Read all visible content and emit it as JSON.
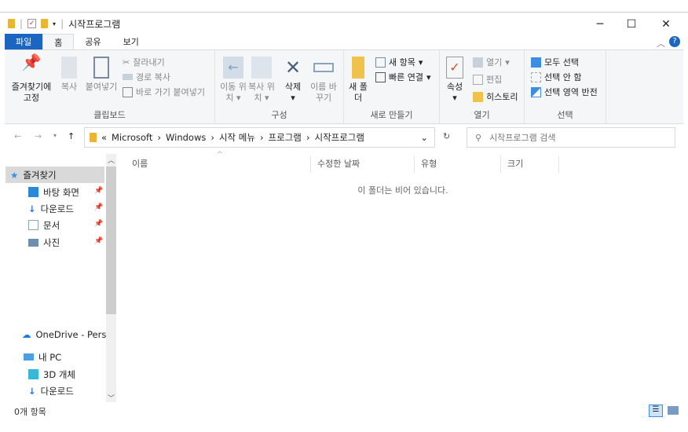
{
  "window": {
    "title": "시작프로그램",
    "minimize": "─",
    "maximize": "☐",
    "close": "✕"
  },
  "tabs": [
    "파일",
    "홈",
    "공유",
    "보기"
  ],
  "ribbon": {
    "clipboard": {
      "label": "클립보드",
      "pin": "즐겨찾기에 고정",
      "copy": "복사",
      "paste": "붙여넣기",
      "cut": "잘라내기",
      "copy_path": "경로 복사",
      "paste_shortcut": "바로 가기 붙여넣기"
    },
    "organize": {
      "label": "구성",
      "move_to": "이동 위치",
      "copy_to": "복사 위치",
      "delete": "삭제",
      "rename": "이름 바꾸기"
    },
    "new": {
      "label": "새로 만들기",
      "new_folder": "새 폴더",
      "new_item": "새 항목",
      "easy_access": "빠른 연결"
    },
    "open": {
      "label": "열기",
      "properties": "속성",
      "open": "열기",
      "edit": "편집",
      "history": "히스토리"
    },
    "select": {
      "label": "선택",
      "select_all": "모두 선택",
      "select_none": "선택 안 함",
      "invert": "선택 영역 반전"
    }
  },
  "address": {
    "prefix": "«",
    "crumbs": [
      "Microsoft",
      "Windows",
      "시작 메뉴",
      "프로그램",
      "시작프로그램"
    ],
    "search_placeholder": "시작프로그램 검색"
  },
  "sidebar": {
    "quick_access": "즐겨찾기",
    "items": [
      "바탕 화면",
      "다운로드",
      "문서",
      "사진"
    ],
    "onedrive": "OneDrive - Person",
    "this_pc": "내 PC",
    "pc_items": [
      "3D 개체",
      "다운로드"
    ]
  },
  "columns": [
    "이름",
    "수정한 날짜",
    "유형",
    "크기"
  ],
  "empty_message": "이 폴더는 비어 있습니다.",
  "status": "0개 항목",
  "colors": {
    "accent": "#1a66c0",
    "ribbon_bg": "#f5f6f7"
  }
}
